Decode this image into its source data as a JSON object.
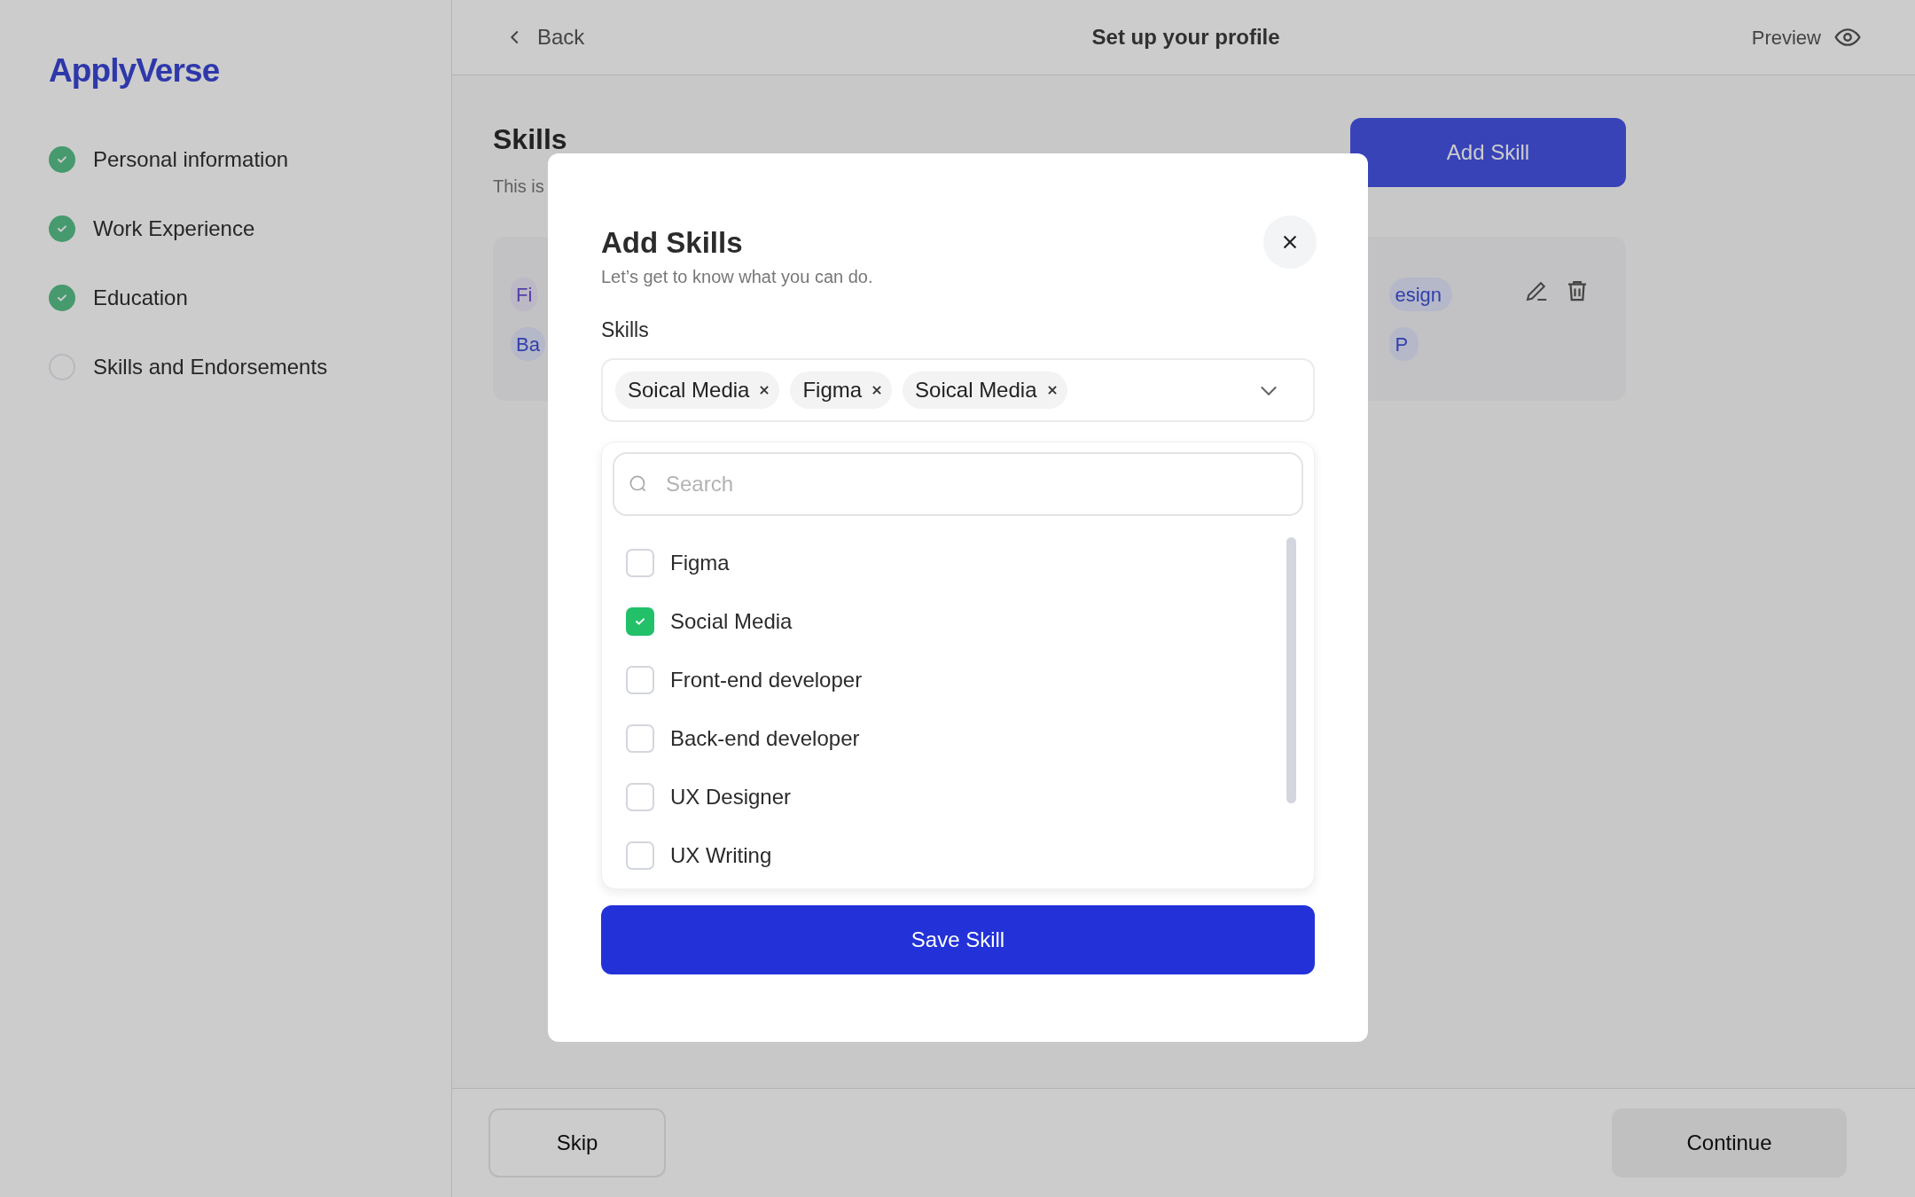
{
  "app": {
    "logo": "ApplyVerse"
  },
  "steps": [
    {
      "label": "Personal information",
      "done": true
    },
    {
      "label": "Work Experience",
      "done": true
    },
    {
      "label": "Education",
      "done": true
    },
    {
      "label": "Skills and Endorsements",
      "done": false
    }
  ],
  "top_bar": {
    "back": "Back",
    "title": "Set up your profile",
    "preview": "Preview"
  },
  "section": {
    "title": "Skills",
    "description": "This is",
    "add_button": "Add Skill",
    "tags_left": [
      "Fi",
      "Ba"
    ],
    "tags_right": [
      "esign",
      "P"
    ]
  },
  "modal": {
    "title": "Add Skills",
    "subtitle": "Let’s get to know what you can do.",
    "field_label": "Skills",
    "selected_tags": [
      "Soical Media",
      "Figma",
      "Soical Media"
    ],
    "search": {
      "placeholder": "Search"
    },
    "options": [
      {
        "label": "Figma",
        "checked": false
      },
      {
        "label": "Social Media",
        "checked": true
      },
      {
        "label": "Front-end developer",
        "checked": false
      },
      {
        "label": "Back-end developer",
        "checked": false
      },
      {
        "label": "UX Designer",
        "checked": false
      },
      {
        "label": "UX Writing",
        "checked": false
      }
    ],
    "save_button": "Save Skill"
  },
  "footer": {
    "skip": "Skip",
    "continue": "Continue"
  }
}
